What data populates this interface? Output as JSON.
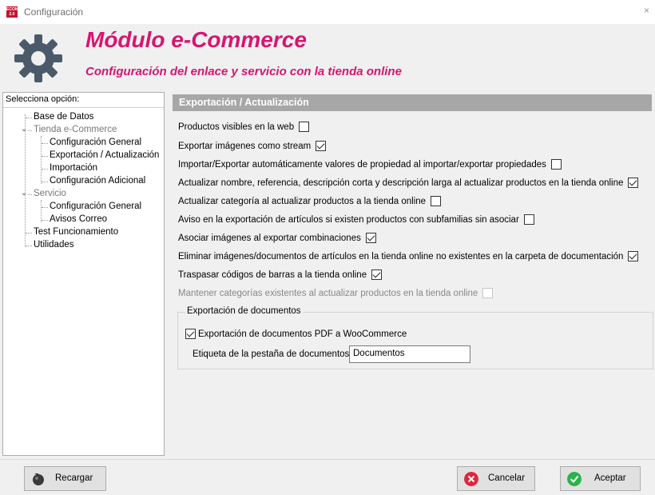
{
  "window": {
    "title": "Configuración",
    "icon_label": "ECOM 2.0",
    "close": "×"
  },
  "header": {
    "title": "Módulo e-Commerce",
    "subtitle": "Configuración del enlace y servicio con la tienda online",
    "icon": "gear-icon"
  },
  "tree": {
    "label": "Selecciona opción:",
    "items": [
      {
        "label": "Base de Datos"
      },
      {
        "label": "Tienda e-Commerce",
        "expanded": true
      },
      {
        "label": "Configuración General"
      },
      {
        "label": "Exportación / Actualización"
      },
      {
        "label": "Importación"
      },
      {
        "label": "Configuración Adicional"
      },
      {
        "label": "Servicio",
        "expanded": true
      },
      {
        "label": "Configuración General"
      },
      {
        "label": "Avisos Correo"
      },
      {
        "label": "Test Funcionamiento"
      },
      {
        "label": "Utilidades"
      }
    ]
  },
  "section": {
    "title": "Exportación / Actualización",
    "options": [
      {
        "label": "Productos visibles en la web",
        "checked": false
      },
      {
        "label": "Exportar imágenes como stream",
        "checked": true
      },
      {
        "label": "Importar/Exportar automáticamente valores de propiedad al importar/exportar propiedades",
        "checked": false
      },
      {
        "label": "Actualizar nombre, referencia, descripción corta y descripción larga al actualizar productos en la tienda online",
        "checked": true
      },
      {
        "label": "Actualizar categoría al actualizar productos a la tienda online",
        "checked": false
      },
      {
        "label": "Aviso en la exportación de artículos si existen productos con subfamilias sin asociar",
        "checked": false
      },
      {
        "label": "Asociar imágenes al exportar combinaciones",
        "checked": true
      },
      {
        "label": "Eliminar imágenes/documentos de artículos en la tienda online no existentes en la carpeta de documentación",
        "checked": true
      },
      {
        "label": "Traspasar códigos de barras a la tienda online",
        "checked": true
      },
      {
        "label": "Mantener categorías existentes al actualizar productos en la tienda online",
        "checked": false,
        "disabled": true
      }
    ]
  },
  "documents": {
    "group_title": "Exportación de documentos",
    "pdf_label": "Exportación de documentos PDF a WooCommerce",
    "pdf_checked": true,
    "tab_label": "Etiqueta de la pestaña de documentos:",
    "tab_value": "Documentos"
  },
  "buttons": {
    "reload": "Recargar",
    "cancel": "Cancelar",
    "accept": "Aceptar"
  },
  "colors": {
    "accent": "#d8156f",
    "section_head": "#a7a7a7",
    "cancel": "#e0253b",
    "accept": "#2bb24c"
  }
}
